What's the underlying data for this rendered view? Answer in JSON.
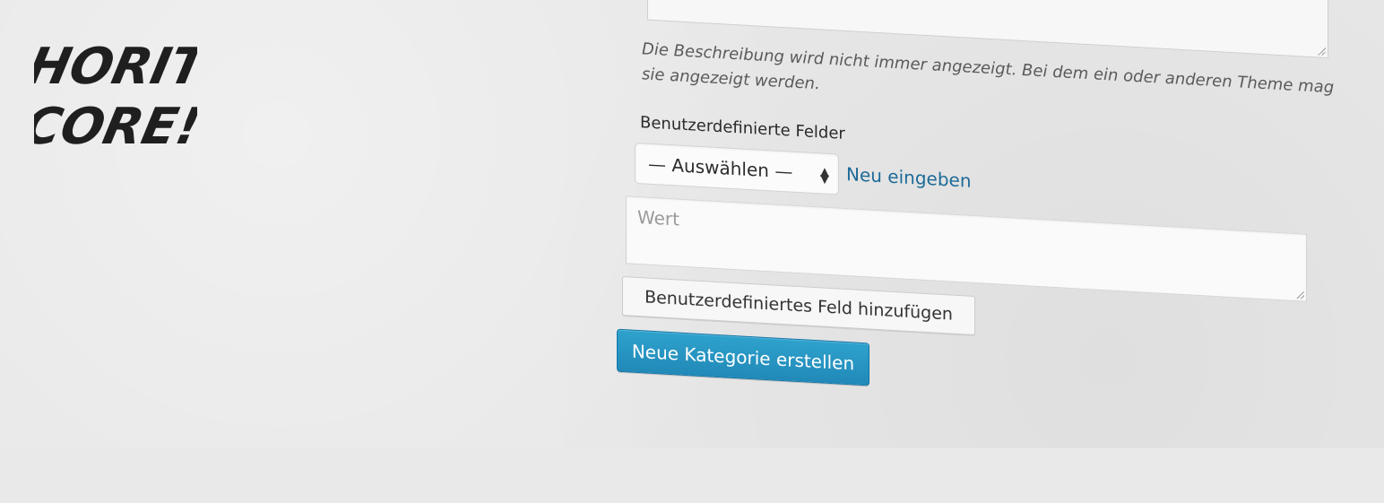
{
  "brand": {
    "line1": "HORIT",
    "line2": "CORE!"
  },
  "description": {
    "hint": "Die Beschreibung wird nicht immer angezeigt. Bei dem ein oder anderen Theme mag sie angezeigt werden."
  },
  "custom_fields": {
    "label": "Benutzerdefinierte Felder",
    "select_value": "— Auswählen —",
    "new_link": "Neu eingeben",
    "value_placeholder": "Wert",
    "add_button": "Benutzerdefiniertes Feld hinzufügen"
  },
  "actions": {
    "submit": "Neue Kategorie erstellen"
  },
  "colors": {
    "primary": "#2ea2cc",
    "link": "#1c6a98"
  },
  "icons": {
    "select": "select-arrows-icon",
    "resize": "resize-handle-icon"
  }
}
